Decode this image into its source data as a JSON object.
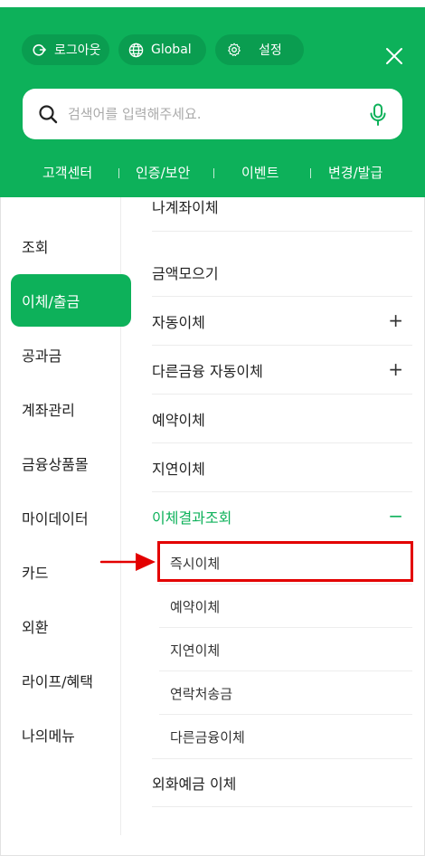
{
  "header": {
    "logout_label": "로그아웃",
    "global_label": "Global",
    "settings_label": "설정",
    "icons": {
      "logout": "logout-icon",
      "global": "globe-icon",
      "settings": "gear-icon",
      "close": "close-icon"
    }
  },
  "search": {
    "placeholder": "검색어를 입력해주세요.",
    "icons": {
      "search": "search-icon",
      "mic": "microphone-icon"
    }
  },
  "quick_links": [
    {
      "label": "고객센터"
    },
    {
      "label": "인증/보안"
    },
    {
      "label": "이벤트"
    },
    {
      "label": "변경/발급"
    }
  ],
  "left_menu": [
    {
      "label": "조회",
      "active": false
    },
    {
      "label": "이체/출금",
      "active": true
    },
    {
      "label": "공과금",
      "active": false
    },
    {
      "label": "계좌관리",
      "active": false
    },
    {
      "label": "금융상품몰",
      "active": false
    },
    {
      "label": "마이데이터",
      "active": false
    },
    {
      "label": "카드",
      "active": false
    },
    {
      "label": "외환",
      "active": false
    },
    {
      "label": "라이프/혜택",
      "active": false
    },
    {
      "label": "나의메뉴",
      "active": false
    }
  ],
  "right_menu": {
    "items": [
      {
        "label": "나계좌이체"
      },
      {
        "label": "금액모으기"
      },
      {
        "label": "자동이체",
        "sign": "+"
      },
      {
        "label": "다른금융 자동이체",
        "sign": "+"
      },
      {
        "label": "예약이체"
      },
      {
        "label": "지연이체"
      },
      {
        "label": "이체결과조회",
        "sign": "−"
      }
    ],
    "sub_items": [
      {
        "label": "즉시이체"
      },
      {
        "label": "예약이체"
      },
      {
        "label": "지연이체"
      },
      {
        "label": "연락처송금"
      },
      {
        "label": "다른금융이체"
      }
    ],
    "last_item": {
      "label": "외화예금 이체"
    }
  },
  "colors": {
    "brand_green": "#0db15a",
    "pill_green": "#0a9d50",
    "highlight_red": "#e30000"
  }
}
